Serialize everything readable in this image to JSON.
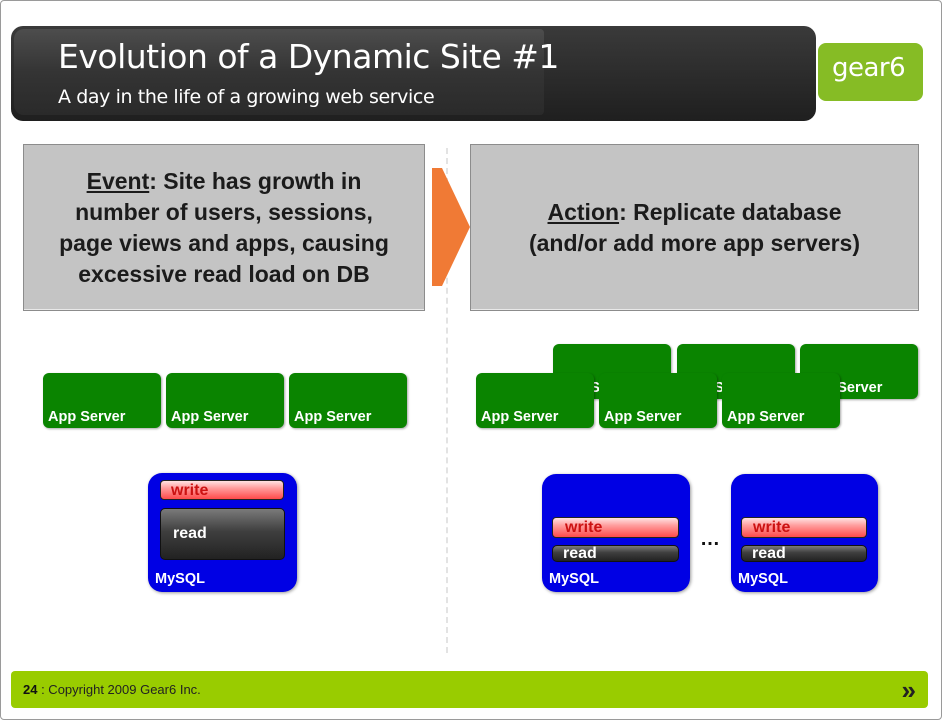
{
  "header": {
    "title": "Evolution of a Dynamic Site #1",
    "subtitle": "A day in the life of a growing web service",
    "logo": "gear6"
  },
  "event": {
    "label": "Event",
    "text_line1": ": Site has growth in",
    "text_line2": "number of users, sessions,",
    "text_line3": "page views and apps, causing",
    "text_line4": "excessive read load on DB"
  },
  "action": {
    "label": "Action",
    "text_line1": ": Replicate database",
    "text_line2": "(and/or add more app servers)"
  },
  "left": {
    "app_servers": [
      "App Server",
      "App Server",
      "App Server"
    ],
    "db": {
      "write": "write",
      "read": "read",
      "label": "MySQL"
    }
  },
  "right": {
    "app_servers_back": [
      "App Server",
      "App Server",
      "App Server"
    ],
    "app_servers_front": [
      "App Server",
      "App Server",
      "App Server"
    ],
    "db1": {
      "write": "write",
      "read": "read",
      "label": "MySQL"
    },
    "db2": {
      "write": "write",
      "read": "read",
      "label": "MySQL"
    },
    "ellipsis": "…"
  },
  "footer": {
    "page_number": "24",
    "copyright": " : Copyright 2009 Gear6 Inc.",
    "next_symbol": "»"
  },
  "colors": {
    "app_server_green": "#0a8400",
    "db_blue": "#0000e4",
    "accent_lime": "#99cc00",
    "arrow_orange": "#f07a35"
  }
}
